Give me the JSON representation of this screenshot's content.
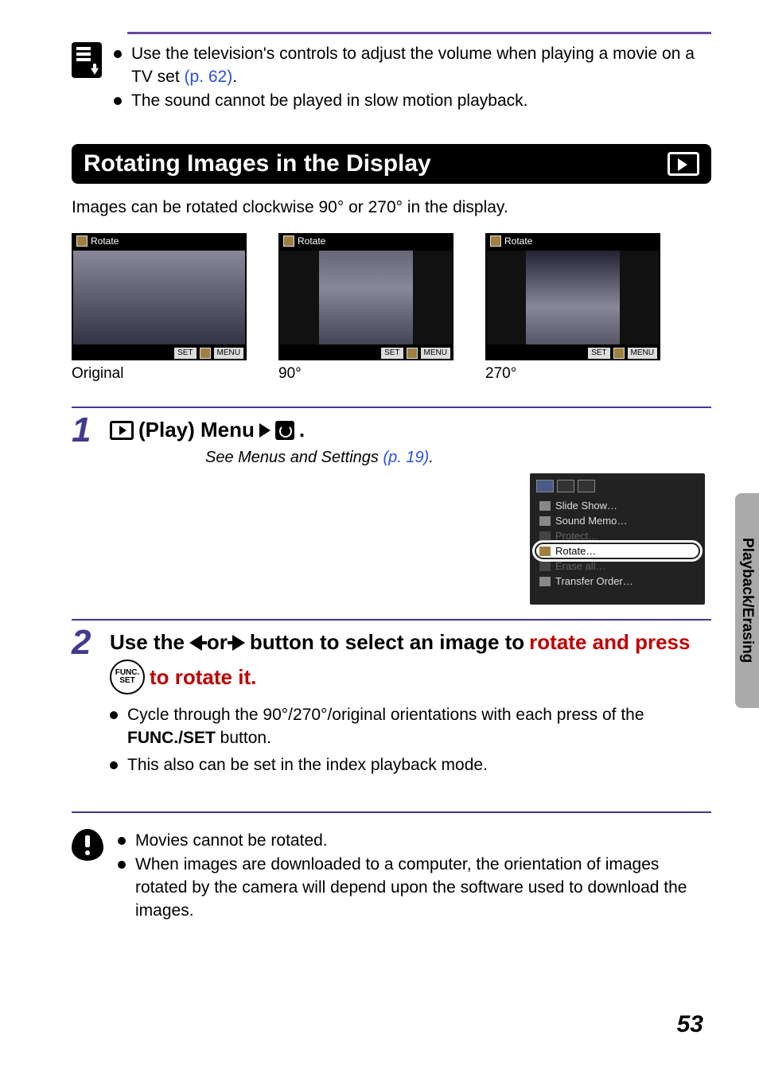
{
  "top_notes": {
    "items": [
      {
        "pre": "Use the television's controls to adjust the volume when playing a movie on a TV set ",
        "link": "(p. 62)",
        "post": "."
      },
      {
        "pre": "The sound cannot be played in slow motion playback.",
        "link": "",
        "post": ""
      }
    ]
  },
  "section": {
    "title": "Rotating Images in the Display"
  },
  "intro": "Images can be rotated clockwise 90° or 270° in the display.",
  "thumbs": {
    "rotate_label": "Rotate",
    "bottom_tags": [
      "SET",
      "MENU"
    ],
    "captions": [
      "Original",
      "90°",
      "270°"
    ]
  },
  "step1": {
    "head_pre": " (Play) Menu",
    "head_post": ".",
    "see_pre": "See Menus and Settings ",
    "see_link": "(p. 19)",
    "see_post": ".",
    "menu_items": [
      "Slide Show…",
      "Sound Memo…",
      "Protect…",
      "Rotate…",
      "Erase all…",
      "Transfer Order…"
    ]
  },
  "step2": {
    "head_t1": "Use the ",
    "head_t2": " or ",
    "head_t3": " button to select an image to ",
    "head_red1": "rotate and press ",
    "head_red2": " to rotate it.",
    "func_top": "FUNC.",
    "func_bottom": "SET",
    "bullets": [
      {
        "pre": "Cycle through the 90°/270°/original orientations with each press of the ",
        "bold": "FUNC./SET",
        "post": " button."
      },
      {
        "pre": "This also can be set in the index playback mode.",
        "bold": "",
        "post": ""
      }
    ]
  },
  "warnings": [
    "Movies cannot be rotated.",
    "When images are downloaded to a computer, the orientation of images rotated by the camera will depend upon the software used to download the images."
  ],
  "side_tab": "Playback/Erasing",
  "page_number": "53"
}
